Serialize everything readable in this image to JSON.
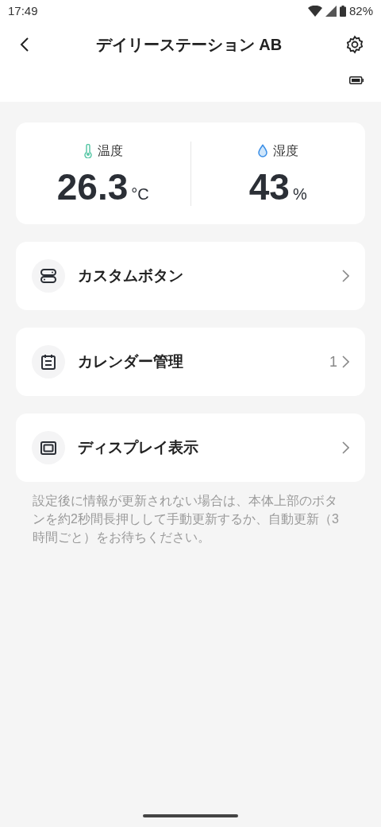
{
  "status_bar": {
    "time": "17:49",
    "battery_percent": "82%"
  },
  "header": {
    "title": "デイリーステーション AB"
  },
  "readings": [
    {
      "kind": "temperature",
      "label": "温度",
      "value": "26.3",
      "unit": "°C"
    },
    {
      "kind": "humidity",
      "label": "湿度",
      "value": "43",
      "unit": "%"
    }
  ],
  "menu": [
    {
      "kind": "buttons",
      "label": "カスタムボタン"
    },
    {
      "kind": "calendar",
      "label": "カレンダー管理",
      "count": "1"
    },
    {
      "kind": "display",
      "label": "ディスプレイ表示"
    }
  ],
  "note": "設定後に情報が更新されない場合は、本体上部のボタンを約2秒間長押しして手動更新するか、自動更新（3時間ごと）をお待ちください。"
}
